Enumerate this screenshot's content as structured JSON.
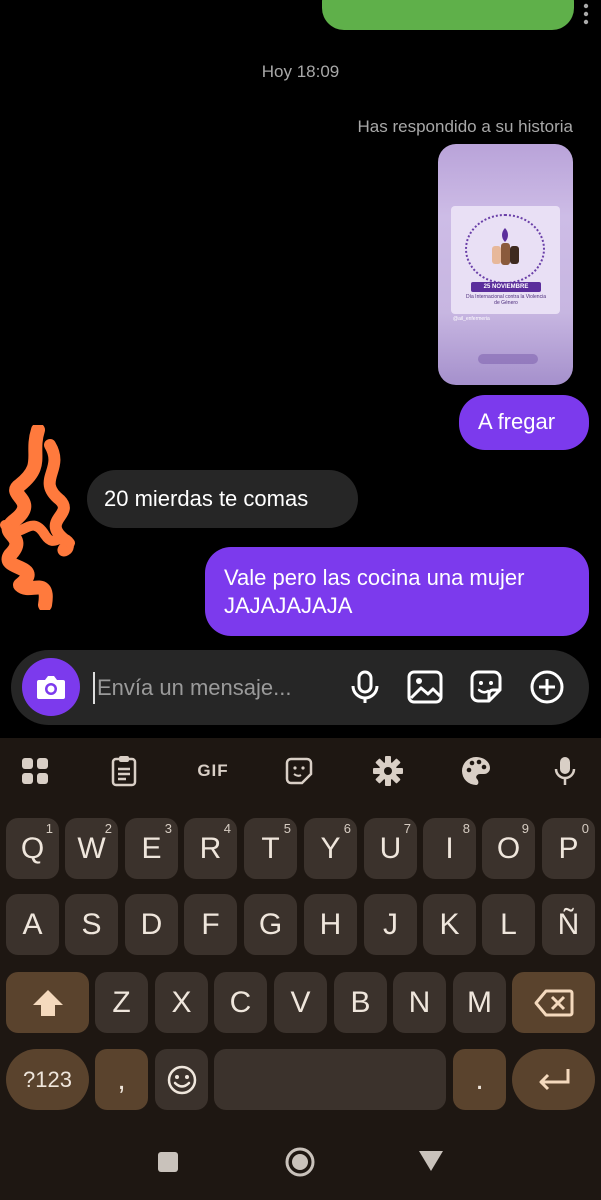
{
  "chat": {
    "timestamp": "Hoy 18:09",
    "story_reply_label": "Has respondido a su historia",
    "story": {
      "banner": "25 NOVIEMBRE",
      "subtitle": "Día Internacional contra la Violencia de Género",
      "handle": "@ail_enfermeria"
    },
    "messages": [
      {
        "side": "out",
        "text": "A fregar"
      },
      {
        "side": "in",
        "text": "20 mierdas te comas"
      },
      {
        "side": "out",
        "text": "Vale pero las cocina una mujer JAJAJAJAJA"
      }
    ]
  },
  "composer": {
    "placeholder": "Envía un mensaje...",
    "icons": [
      "camera-icon",
      "microphone-icon",
      "gallery-icon",
      "sticker-icon",
      "plus-icon"
    ]
  },
  "keyboard": {
    "toolbar_icons": [
      "apps-grid-icon",
      "clipboard-icon",
      "gif-icon",
      "sticker-icon",
      "settings-icon",
      "palette-icon",
      "microphone-icon"
    ],
    "gif_label": "GIF",
    "row1": [
      {
        "k": "Q",
        "h": "1"
      },
      {
        "k": "W",
        "h": "2"
      },
      {
        "k": "E",
        "h": "3"
      },
      {
        "k": "R",
        "h": "4"
      },
      {
        "k": "T",
        "h": "5"
      },
      {
        "k": "Y",
        "h": "6"
      },
      {
        "k": "U",
        "h": "7"
      },
      {
        "k": "I",
        "h": "8"
      },
      {
        "k": "O",
        "h": "9"
      },
      {
        "k": "P",
        "h": "0"
      }
    ],
    "row2": [
      "A",
      "S",
      "D",
      "F",
      "G",
      "H",
      "J",
      "K",
      "L",
      "Ñ"
    ],
    "row3": [
      "Z",
      "X",
      "C",
      "V",
      "B",
      "N",
      "M"
    ],
    "symbols_label": "?123",
    "comma_label": ",",
    "period_label": "."
  },
  "colors": {
    "accent": "#7c3aed",
    "incoming_bubble": "#262626",
    "keyboard_bg": "#1e1712",
    "key_bg": "#3b322c",
    "special_key_bg": "#5a432d"
  }
}
